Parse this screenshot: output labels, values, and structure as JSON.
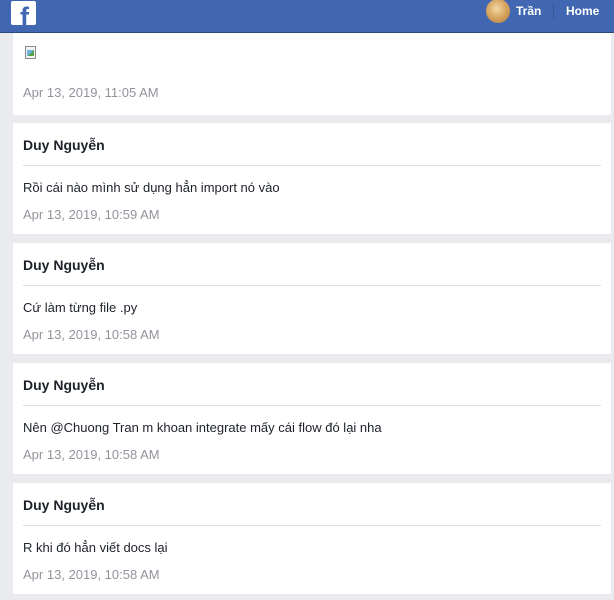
{
  "topbar": {
    "logo_letter": "f",
    "profile_name": "Trần",
    "home_label": "Home"
  },
  "colors": {
    "topbar_bg": "#4267b2",
    "page_bg": "#e9ebee",
    "card_bg": "#ffffff",
    "timestamp_text": "#90949c"
  },
  "feed": {
    "first_item": {
      "timestamp": "Apr 13, 2019, 11:05 AM"
    },
    "messages": [
      {
        "author": "Duy Nguyễn",
        "text": "Rồi cái nào mình sử dụng hẳn import nó vào",
        "timestamp": "Apr 13, 2019, 10:59 AM"
      },
      {
        "author": "Duy Nguyễn",
        "text": "Cứ làm từng file .py",
        "timestamp": "Apr 13, 2019, 10:58 AM"
      },
      {
        "author": "Duy Nguyễn",
        "text": "Nên @Chuong Tran m khoan integrate mấy cái flow đó lại nha",
        "timestamp": "Apr 13, 2019, 10:58 AM"
      },
      {
        "author": "Duy Nguyễn",
        "text": "R khi đó hẳn viết docs lại",
        "timestamp": "Apr 13, 2019, 10:58 AM"
      }
    ]
  }
}
